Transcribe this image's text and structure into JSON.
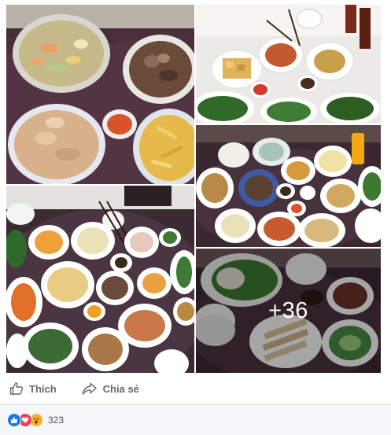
{
  "photos": {
    "more_label": "+36"
  },
  "actions": {
    "like_label": "Thích",
    "share_label": "Chia sẻ"
  },
  "reactions": {
    "icons": [
      "like-icon",
      "love-icon",
      "wow-icon"
    ],
    "count": "323"
  },
  "colors": {
    "action_text": "#606770",
    "like_blue": "#1877f2",
    "love_red": "#f33e58",
    "wow_yellow": "#f7b125",
    "footer_bg": "#f6f7f9"
  }
}
